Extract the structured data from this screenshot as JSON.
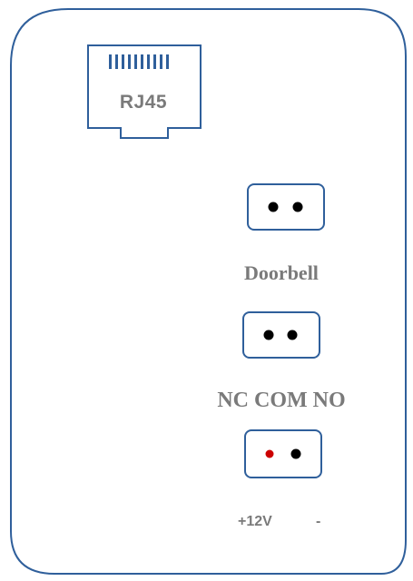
{
  "ports": {
    "ethernet": {
      "label": "RJ45"
    },
    "doorbell": {
      "label": "Doorbell"
    },
    "relay": {
      "label": "NC COM NO"
    },
    "power": {
      "plus_label": "+12V",
      "minus_label": "-"
    }
  },
  "colors": {
    "outline": "#2f5f9b",
    "label": "#7a7a7a",
    "pin": "#000000",
    "positive_pin": "#cc0000"
  }
}
